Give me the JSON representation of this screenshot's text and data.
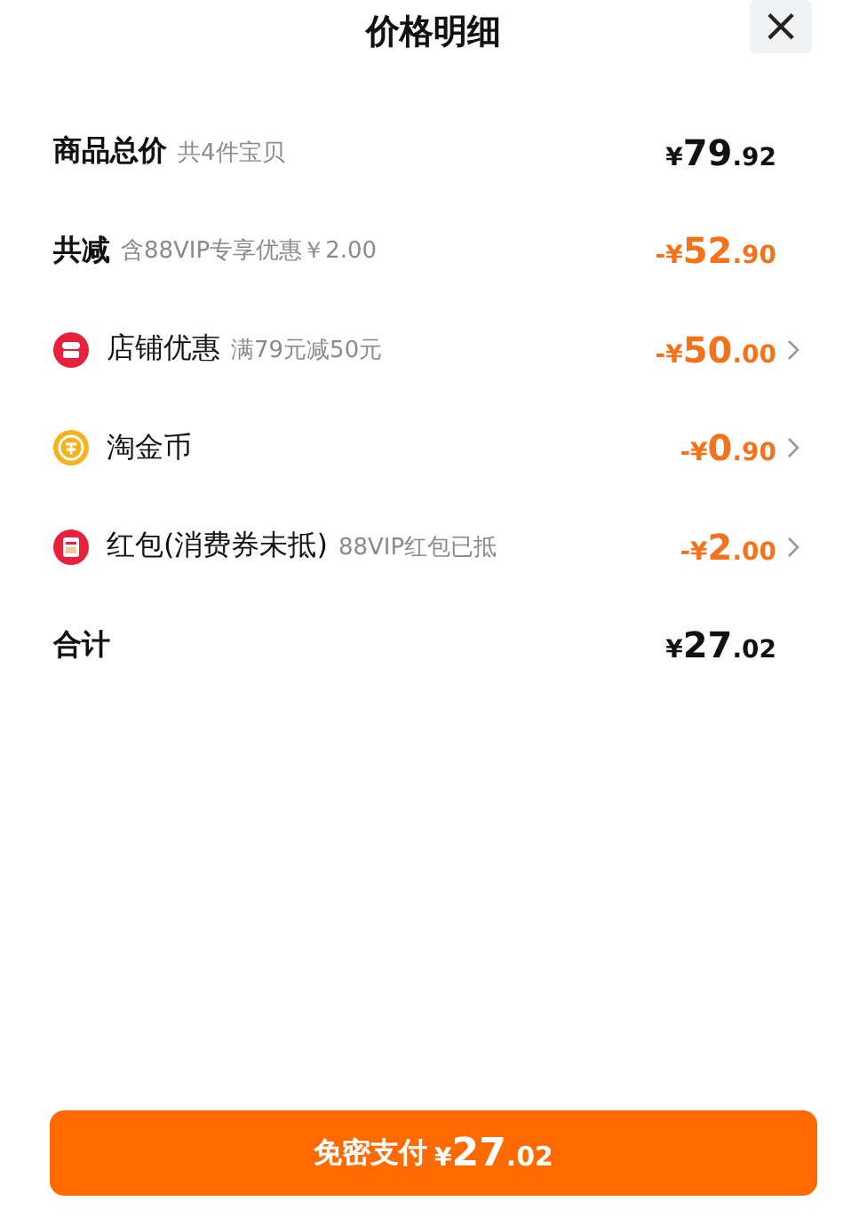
{
  "header": {
    "title": "价格明细",
    "close": "×"
  },
  "rows": [
    {
      "kind": "summary",
      "label": "商品总价",
      "note": "共4件宝贝",
      "amount": {
        "color": "#111111",
        "currency": "¥",
        "whole": "79",
        "fraction": ".92"
      },
      "expandable": false
    },
    {
      "kind": "summary",
      "label": "共减",
      "note": "含88VIP专享优惠￥2.00",
      "amount": {
        "color": "#f4731a",
        "currency": "-¥",
        "whole": "52",
        "fraction": ".90"
      },
      "expandable": false
    },
    {
      "kind": "shop",
      "label": "店铺优惠",
      "note": "满79元减50元",
      "amount": {
        "color": "#f4731a",
        "currency": "-¥",
        "whole": "50",
        "fraction": ".00"
      },
      "expandable": true
    },
    {
      "kind": "coin",
      "label": "淘金币",
      "amount": {
        "color": "#f4731a",
        "currency": "-¥",
        "whole": "0",
        "fraction": ".90"
      },
      "expandable": true
    },
    {
      "kind": "packet",
      "label": "红包(消费券未抵)",
      "note": "88VIP红包已抵",
      "amount": {
        "color": "#f4731a",
        "currency": "-¥",
        "whole": "2",
        "fraction": ".00"
      },
      "expandable": true
    },
    {
      "kind": "summary",
      "label": "合计",
      "amount": {
        "color": "#111111",
        "currency": "¥",
        "whole": "27",
        "fraction": ".02"
      },
      "expandable": false
    }
  ],
  "pay_button": {
    "label": "免密支付",
    "currency": "¥",
    "whole": "27",
    "fraction": ".02"
  }
}
